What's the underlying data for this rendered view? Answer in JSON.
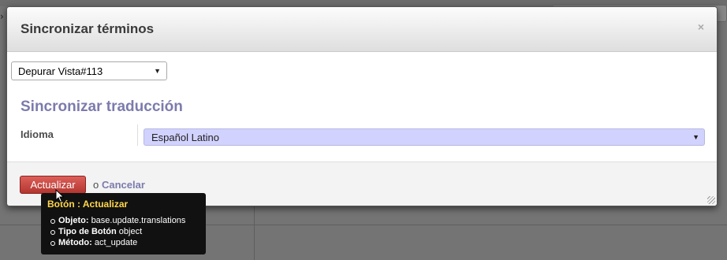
{
  "modal": {
    "title": "Sincronizar términos",
    "close_symbol": "×"
  },
  "debug": {
    "selected": "Depurar Vista#113"
  },
  "form": {
    "title": "Sincronizar traducción",
    "language_label": "Idioma",
    "language_value": "Español Latino"
  },
  "footer": {
    "update_label": "Actualizar",
    "or_text": "o",
    "cancel_label": "Cancelar"
  },
  "tooltip": {
    "title": "Botón : Actualizar",
    "items": [
      {
        "key": "Objeto:",
        "value": "base.update.translations"
      },
      {
        "key": "Tipo de Botón",
        "value": "object"
      },
      {
        "key": "Método:",
        "value": "act_update"
      }
    ]
  },
  "colors": {
    "accent": "#7c7bad",
    "button_red": "#c9443e",
    "select_highlight": "#d2d2ff",
    "tooltip_title": "#ffd74c"
  }
}
